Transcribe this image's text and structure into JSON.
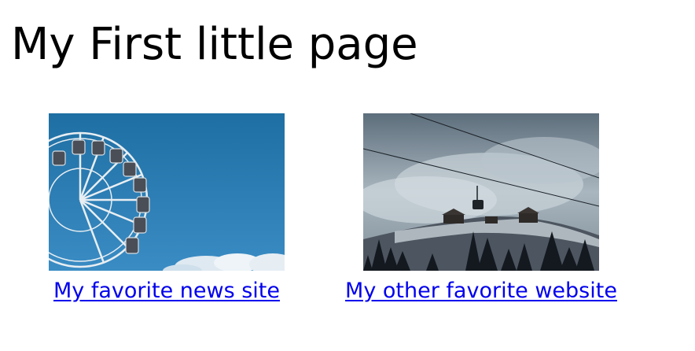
{
  "page": {
    "title": "My First little page"
  },
  "links": [
    {
      "label": "My favorite news site"
    },
    {
      "label": "My other favorite website"
    }
  ],
  "images": [
    {
      "icon": "ferris-wheel-photo"
    },
    {
      "icon": "cable-car-mountain-photo"
    }
  ],
  "colors": {
    "link": "#0000ee",
    "text": "#000000"
  }
}
